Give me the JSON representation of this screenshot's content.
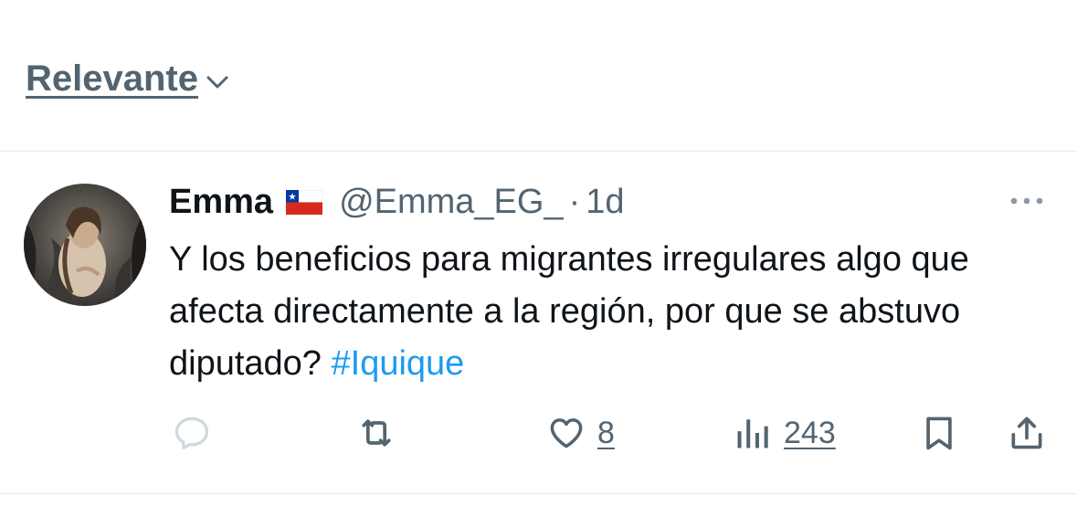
{
  "sort": {
    "label": "Relevante"
  },
  "tweet": {
    "author_name": "Emma",
    "handle": "@Emma_EG_",
    "separator": "·",
    "time": "1d",
    "text": "Y los beneficios para migrantes irregulares algo que afecta directamente a la región, por que se abstuvo diputado? ",
    "hashtag": "#Iquique",
    "likes": "8",
    "views": "243",
    "flag_icon": "chile-flag-icon"
  },
  "colors": {
    "text_primary": "#0f1419",
    "text_secondary": "#536471",
    "link": "#1d9bf0",
    "divider": "#e6e9ec"
  }
}
